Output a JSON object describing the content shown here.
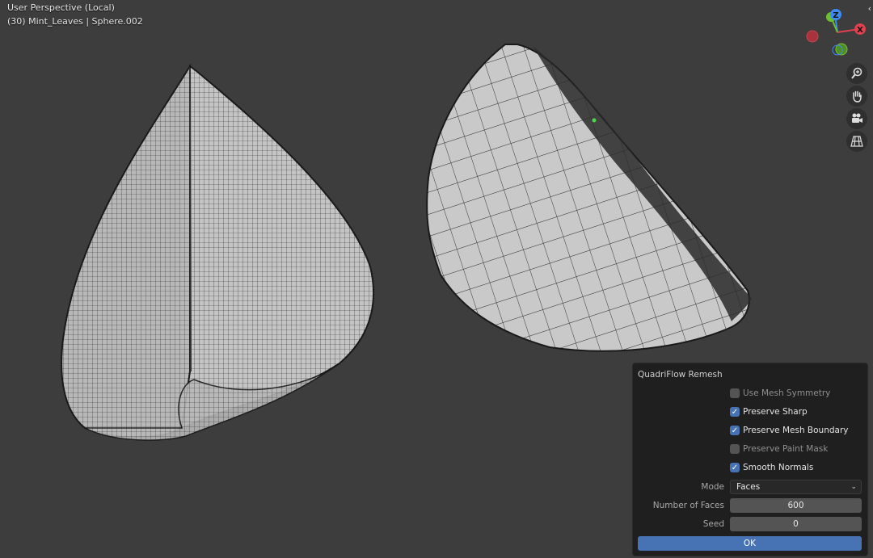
{
  "viewport": {
    "view_name": "User Perspective (Local)",
    "object_info": "(30) Mint_Leaves | Sphere.002"
  },
  "gizmo": {
    "z_label": "Z",
    "x_label": "X",
    "y_label": "Y"
  },
  "nav_tools": [
    {
      "icon": "zoom-icon"
    },
    {
      "icon": "hand-icon"
    },
    {
      "icon": "camera-icon"
    },
    {
      "icon": "grid-icon"
    }
  ],
  "panel": {
    "title": "QuadriFlow Remesh",
    "options": [
      {
        "label": "Use Mesh Symmetry",
        "checked": false
      },
      {
        "label": "Preserve Sharp",
        "checked": true
      },
      {
        "label": "Preserve Mesh Boundary",
        "checked": true
      },
      {
        "label": "Preserve Paint Mask",
        "checked": false
      },
      {
        "label": "Smooth Normals",
        "checked": true
      }
    ],
    "mode_label": "Mode",
    "mode_value": "Faces",
    "faces_label": "Number of Faces",
    "faces_value": "600",
    "seed_label": "Seed",
    "seed_value": "0",
    "ok_label": "OK"
  },
  "colors": {
    "accent": "#4772b3",
    "background": "#3d3d3d",
    "mesh": "#bdbdbd"
  }
}
